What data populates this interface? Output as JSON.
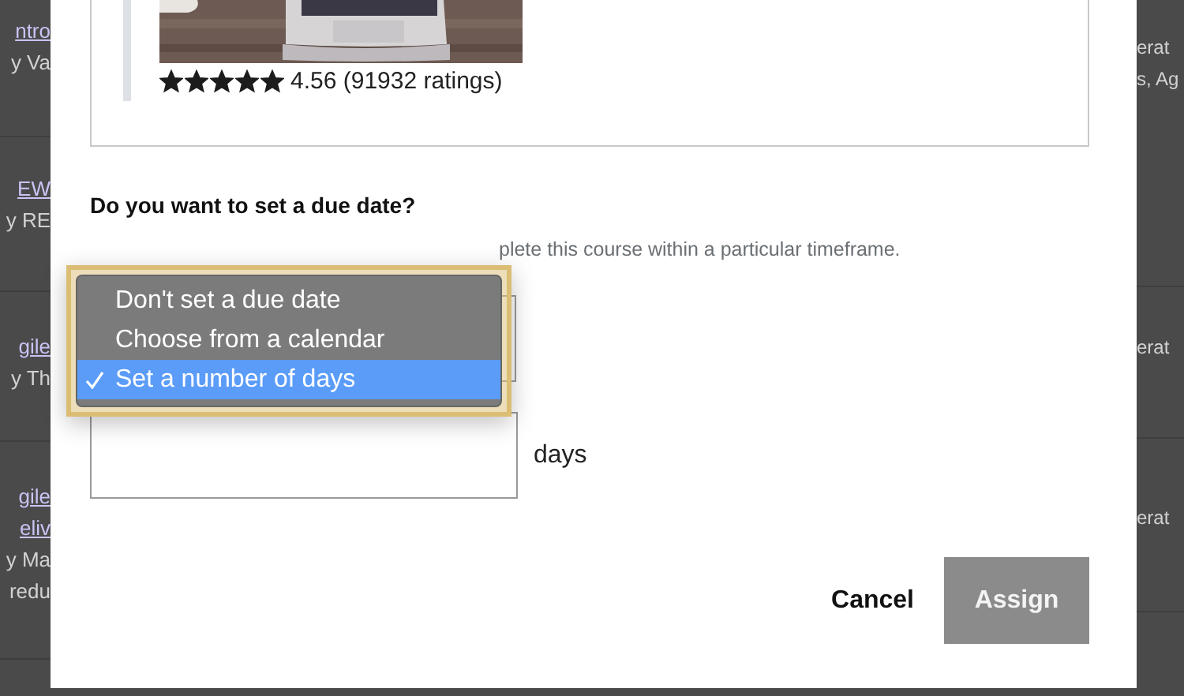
{
  "background_page": {
    "left_rows": [
      {
        "lines": [
          {
            "text": "ntro",
            "kind": "link"
          },
          {
            "text": "y Va",
            "kind": "byline"
          }
        ]
      },
      {
        "lines": [
          {
            "text": "EW",
            "kind": "link"
          },
          {
            "text": "y RE",
            "kind": "byline"
          }
        ]
      },
      {
        "lines": [
          {
            "text": "gile",
            "kind": "link"
          },
          {
            "text": "y Th",
            "kind": "byline"
          }
        ]
      },
      {
        "lines": [
          {
            "text": "gile",
            "kind": "link"
          },
          {
            "text": "eliv",
            "kind": "link"
          },
          {
            "text": "y Ma",
            "kind": "byline"
          },
          {
            "text": "redu",
            "kind": "byline"
          }
        ]
      }
    ],
    "right_rows": [
      {
        "lines": [
          {
            "text": "erat",
            "kind": "byline"
          },
          {
            "text": "s, Ag",
            "kind": "byline"
          }
        ]
      },
      {
        "lines": [
          {
            "text": "erat",
            "kind": "byline"
          }
        ]
      },
      {
        "lines": [
          {
            "text": "erat",
            "kind": "byline"
          }
        ]
      }
    ]
  },
  "course_card": {
    "rating": {
      "stars": 5,
      "text": "4.56 (91932 ratings)"
    }
  },
  "due_date": {
    "heading": "Do you want to set a due date?",
    "description": "plete this course within a particular timeframe.",
    "select": {
      "expanded": true,
      "options": [
        {
          "label": "Don't set a due date",
          "selected": false
        },
        {
          "label": "Choose from a calendar",
          "selected": false
        },
        {
          "label": "Set a number of days",
          "selected": true
        }
      ]
    },
    "days_field": {
      "unit": "days"
    }
  },
  "buttons": [
    {
      "label": "Cancel",
      "kind": "text"
    },
    {
      "label": "Assign",
      "kind": "filled",
      "disabled": true
    }
  ]
}
